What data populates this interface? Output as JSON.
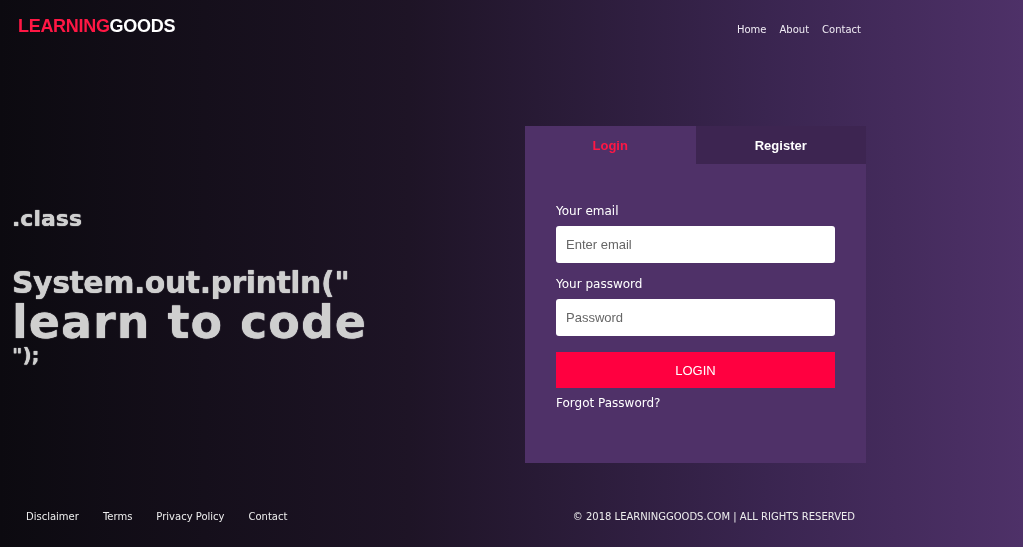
{
  "logo": {
    "primary": "LEARNING",
    "secondary": "GOODS"
  },
  "nav": [
    "Home",
    "About",
    "Contact"
  ],
  "hero": [
    ".class",
    "System.out.println(\"",
    "learn to code",
    "\");"
  ],
  "tabs": [
    {
      "label": "Login",
      "selected": true
    },
    {
      "label": "Register",
      "selected": false
    }
  ],
  "form": {
    "email_label": "Your email",
    "email_placeholder": "Enter email",
    "password_label": "Your password",
    "password_placeholder": "Password",
    "submit": "LOGIN",
    "forgot": "Forgot Password?"
  },
  "footer_links": [
    "Disclaimer",
    "Terms",
    "Privacy Policy",
    "Contact"
  ],
  "copyright": "© 2018 LEARNINGGOODS.COM | ALL RIGHTS RESERVED"
}
